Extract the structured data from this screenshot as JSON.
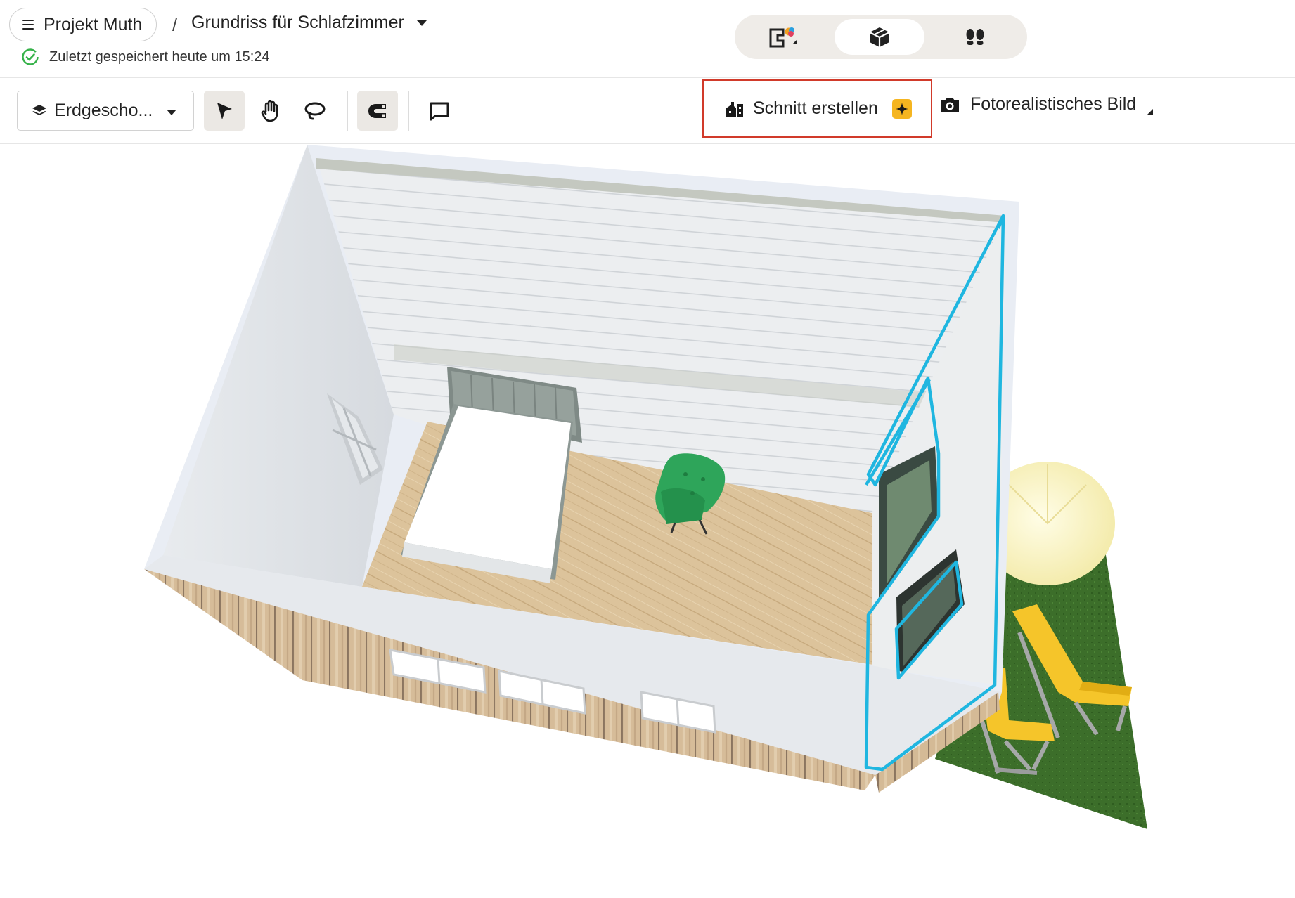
{
  "header": {
    "project_name": "Projekt Muth",
    "breadcrumb_separator": "/",
    "plan_title": "Grundriss für Schlafzimmer",
    "save_status": "Zuletzt gespeichert heute um 15:24",
    "view_modes": [
      {
        "name": "2D-Grundriss",
        "icon": "floorplan-2d-icon",
        "active": false
      },
      {
        "name": "3D-Ansicht",
        "icon": "cube-3d-icon",
        "active": true
      },
      {
        "name": "Rundgang",
        "icon": "footsteps-icon",
        "active": false
      }
    ]
  },
  "toolbar": {
    "floor_select": "Erdgescho...",
    "tools": [
      {
        "icon": "cursor-icon",
        "active": true
      },
      {
        "icon": "hand-icon",
        "active": false
      },
      {
        "icon": "lasso-icon",
        "active": false
      },
      {
        "icon": "magnet-icon",
        "active": true
      },
      {
        "icon": "comment-icon",
        "active": false
      }
    ],
    "section_button": "Schnitt erstellen",
    "photo_button": "Fotorealistisches Bild"
  },
  "colors": {
    "accent_highlight": "#d13a2a",
    "selection_outline": "#1fb6e0",
    "save_ok": "#36b24a",
    "ai_badge": "#f5b520"
  }
}
